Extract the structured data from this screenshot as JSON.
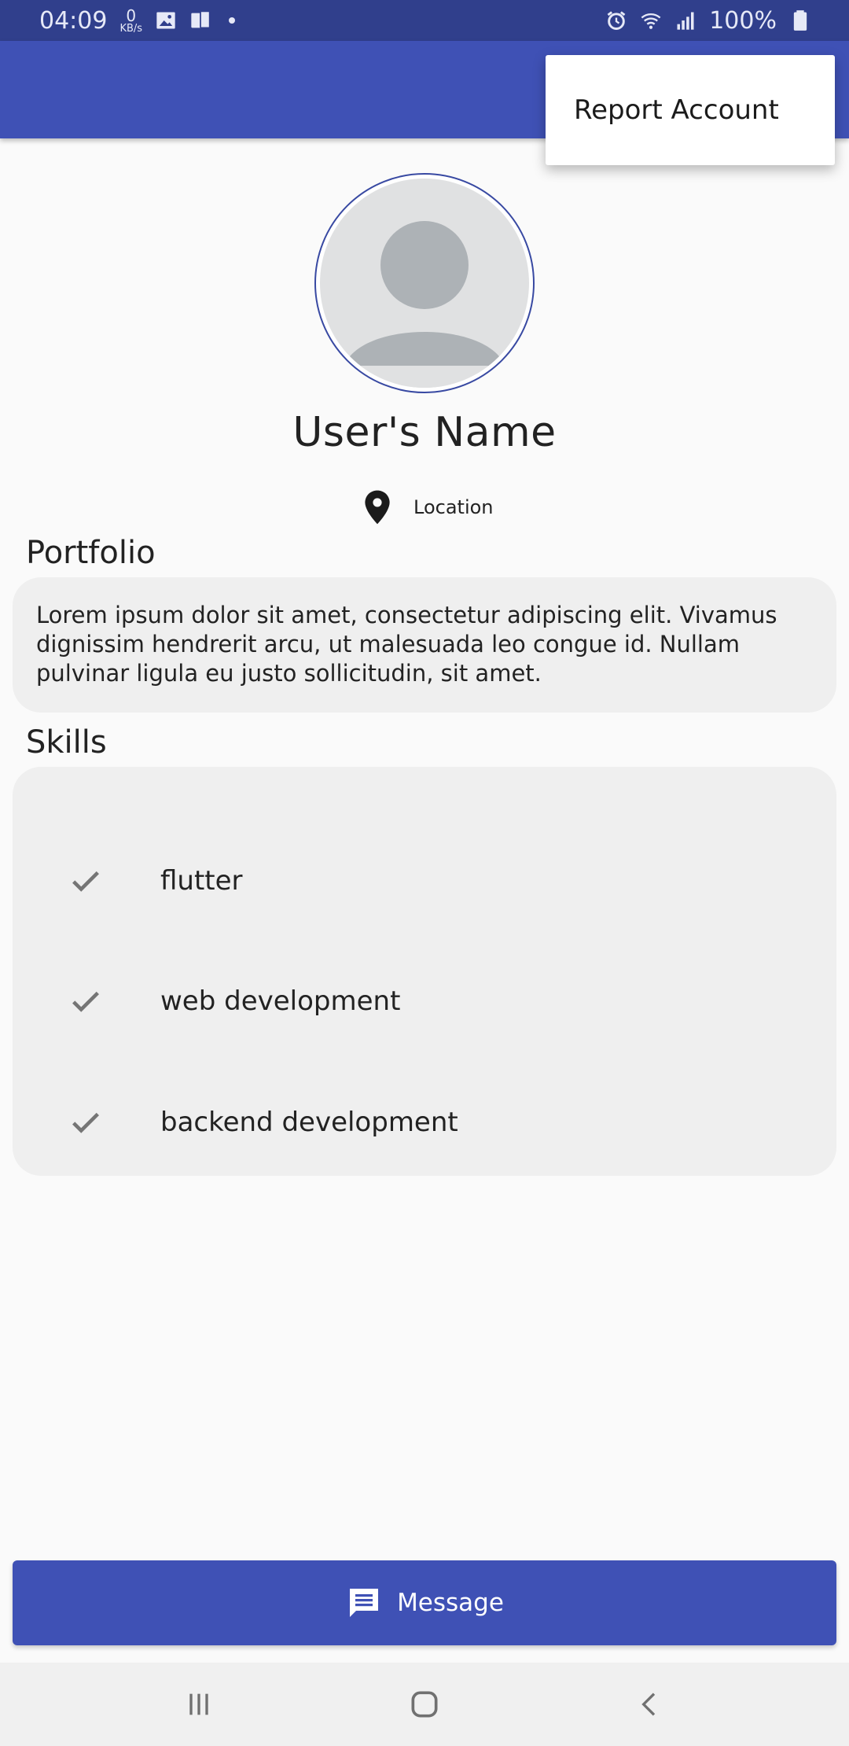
{
  "status_bar": {
    "time": "04:09",
    "net_speed_value": "0",
    "net_speed_unit": "KB/s",
    "battery": "100%"
  },
  "menu": {
    "items": [
      "Report Account"
    ]
  },
  "profile": {
    "name": "User's Name",
    "location": "Location"
  },
  "portfolio": {
    "title": "Portfolio",
    "text": "Lorem ipsum dolor sit amet, consectetur adipiscing elit. Vivamus dignissim hendrerit arcu, ut malesuada leo congue id. Nullam pulvinar ligula eu justo sollicitudin, sit amet."
  },
  "skills": {
    "title": "Skills",
    "items": [
      "flutter",
      "web development",
      "backend development"
    ]
  },
  "actions": {
    "message_label": "Message"
  },
  "colors": {
    "primary": "#3f51b5",
    "status_bar": "#303f8c",
    "card_background": "#efefef"
  },
  "icons": {
    "location": "location-pin-icon",
    "skill": "check-icon",
    "message": "chat-bubble-icon"
  }
}
